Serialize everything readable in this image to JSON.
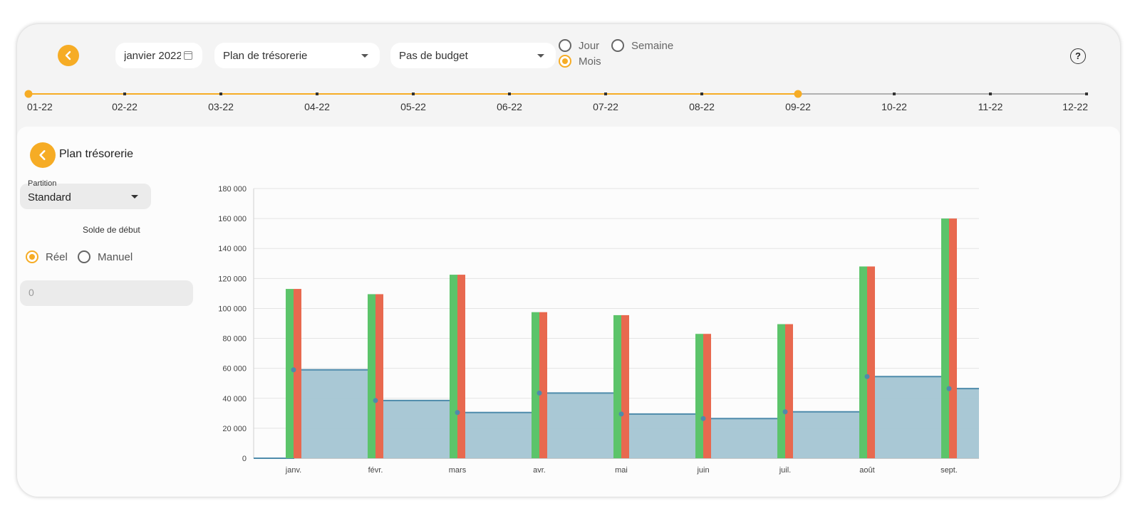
{
  "toolbar": {
    "date_value": "janvier 2022",
    "plan_select": "Plan de trésorerie",
    "budget_select": "Pas de budget",
    "radio_jour": "Jour",
    "radio_semaine": "Semaine",
    "radio_mois": "Mois",
    "selected_period": "Mois",
    "help_label": "?"
  },
  "timeline": {
    "labels": [
      "01-22",
      "02-22",
      "03-22",
      "04-22",
      "05-22",
      "06-22",
      "07-22",
      "08-22",
      "09-22",
      "10-22",
      "11-22",
      "12-22"
    ],
    "range_start": "01-22",
    "range_end": "09-22"
  },
  "panel": {
    "title": "Plan trésorerie",
    "partition_label": "Partition",
    "partition_value": "Standard",
    "solde_label": "Solde de début",
    "radio_reel": "Réel",
    "radio_manuel": "Manuel",
    "selected_solde": "Réel",
    "solde_value": "0"
  },
  "colors": {
    "accent": "#f6ac25",
    "income": "#5cc46a",
    "expense": "#e8694f",
    "balance_fill": "#a4c5d3",
    "balance_line": "#4e8bab"
  },
  "chart_data": {
    "type": "bar",
    "categories": [
      "janv.",
      "févr.",
      "mars",
      "avr.",
      "mai",
      "juin",
      "juil.",
      "août",
      "sept."
    ],
    "series": [
      {
        "values": [
          113000,
          109500,
          122500,
          97500,
          95500,
          83000,
          89500,
          128000,
          160000
        ]
      },
      {
        "values": [
          113000,
          109500,
          122500,
          97500,
          95500,
          83000,
          89500,
          128000,
          160000
        ]
      },
      {
        "values": [
          59000,
          38500,
          30500,
          43500,
          29500,
          26500,
          31000,
          54500,
          46500
        ]
      }
    ],
    "yticks": [
      "0",
      "20 000",
      "40 000",
      "60 000",
      "80 000",
      "100 000",
      "120 000",
      "140 000",
      "160 000",
      "180 000"
    ],
    "ylim": [
      0,
      180000
    ],
    "grid": true
  }
}
